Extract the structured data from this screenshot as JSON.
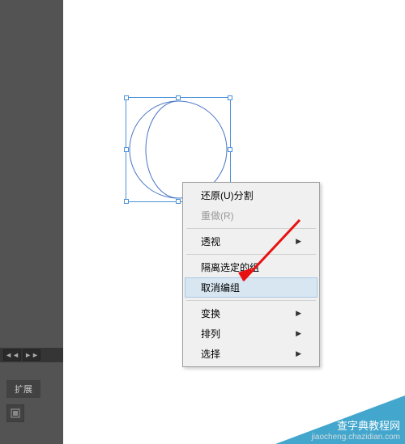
{
  "panel": {
    "tab_label": "扩展",
    "nav_left": "◄◄",
    "nav_right": "►►"
  },
  "menu": {
    "items": [
      {
        "label": "还原(U)分割",
        "disabled": false,
        "submenu": false
      },
      {
        "label": "重做(R)",
        "disabled": true,
        "submenu": false
      },
      {
        "sep": true
      },
      {
        "label": "透视",
        "disabled": false,
        "submenu": true
      },
      {
        "sep": true
      },
      {
        "label": "隔离选定的组",
        "disabled": false,
        "submenu": false
      },
      {
        "label": "取消编组",
        "disabled": false,
        "submenu": false,
        "highlight": true
      },
      {
        "sep": true
      },
      {
        "label": "变换",
        "disabled": false,
        "submenu": true
      },
      {
        "label": "排列",
        "disabled": false,
        "submenu": true
      },
      {
        "label": "选择",
        "disabled": false,
        "submenu": true
      }
    ]
  },
  "watermark": {
    "line1": "查字典教程网",
    "line2": "jiaocheng.chazidian.com"
  }
}
